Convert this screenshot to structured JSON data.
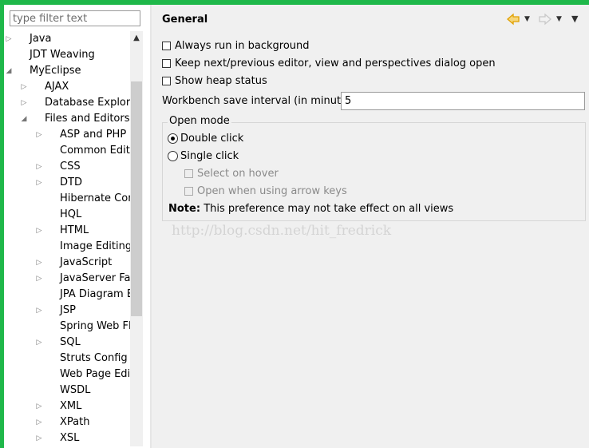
{
  "filter": {
    "placeholder": "type filter text"
  },
  "tree": [
    {
      "label": "Java",
      "level": 0,
      "toggle": "collapsed"
    },
    {
      "label": "JDT Weaving",
      "level": 0,
      "toggle": "none"
    },
    {
      "label": "MyEclipse",
      "level": 0,
      "toggle": "expanded"
    },
    {
      "label": "AJAX",
      "level": 1,
      "toggle": "collapsed"
    },
    {
      "label": "Database Explorer",
      "level": 1,
      "toggle": "collapsed"
    },
    {
      "label": "Files and Editors",
      "level": 1,
      "toggle": "expanded"
    },
    {
      "label": "ASP and PHP",
      "level": 2,
      "toggle": "collapsed"
    },
    {
      "label": "Common Editors",
      "level": 2,
      "toggle": "none"
    },
    {
      "label": "CSS",
      "level": 2,
      "toggle": "collapsed"
    },
    {
      "label": "DTD",
      "level": 2,
      "toggle": "collapsed"
    },
    {
      "label": "Hibernate Config",
      "level": 2,
      "toggle": "none"
    },
    {
      "label": "HQL",
      "level": 2,
      "toggle": "none"
    },
    {
      "label": "HTML",
      "level": 2,
      "toggle": "collapsed"
    },
    {
      "label": "Image Editing",
      "level": 2,
      "toggle": "none"
    },
    {
      "label": "JavaScript",
      "level": 2,
      "toggle": "collapsed"
    },
    {
      "label": "JavaServer Faces",
      "level": 2,
      "toggle": "collapsed"
    },
    {
      "label": "JPA Diagram Editor",
      "level": 2,
      "toggle": "none"
    },
    {
      "label": "JSP",
      "level": 2,
      "toggle": "collapsed"
    },
    {
      "label": "Spring Web Flow",
      "level": 2,
      "toggle": "none"
    },
    {
      "label": "SQL",
      "level": 2,
      "toggle": "collapsed"
    },
    {
      "label": "Struts Config",
      "level": 2,
      "toggle": "none"
    },
    {
      "label": "Web Page Editor",
      "level": 2,
      "toggle": "none"
    },
    {
      "label": "WSDL",
      "level": 2,
      "toggle": "none"
    },
    {
      "label": "XML",
      "level": 2,
      "toggle": "collapsed"
    },
    {
      "label": "XPath",
      "level": 2,
      "toggle": "collapsed"
    },
    {
      "label": "XSL",
      "level": 2,
      "toggle": "collapsed"
    }
  ],
  "page": {
    "title": "General",
    "options": {
      "always_run_background": {
        "label": "Always run in background",
        "checked": false
      },
      "keep_dialog_open": {
        "label": "Keep next/previous editor, view and perspectives dialog open",
        "checked": false
      },
      "show_heap_status": {
        "label": "Show heap status",
        "checked": false
      }
    },
    "save_interval": {
      "label": "Workbench save interval (in minutes):",
      "value": "5"
    },
    "open_mode": {
      "title": "Open mode",
      "double_click": {
        "label": "Double click",
        "selected": true
      },
      "single_click": {
        "label": "Single click",
        "selected": false
      },
      "select_on_hover": {
        "label": "Select on hover",
        "checked": false
      },
      "open_arrow_keys": {
        "label": "Open when using arrow keys",
        "checked": false
      },
      "note_label": "Note:",
      "note_text": "This preference may not take effect on all views"
    }
  },
  "watermark": "http://blog.csdn.net/hit_fredrick",
  "colors": {
    "frame": "#1fb84a",
    "back_arrow": "#e0a000",
    "forward_arrow": "#c8c8c8"
  }
}
